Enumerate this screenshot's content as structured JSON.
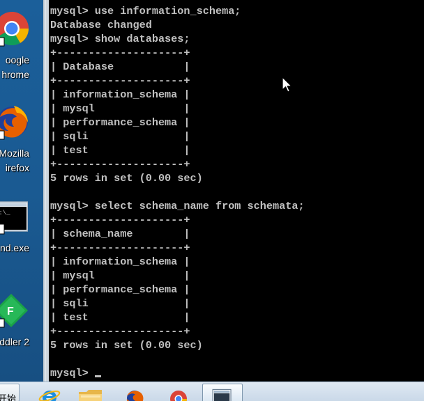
{
  "desktop": {
    "icons": [
      {
        "name": "google-chrome",
        "label_line1": "oogle",
        "label_line2": "hrome"
      },
      {
        "name": "mozilla-firefox",
        "label_line1": "Mozilla",
        "label_line2": "irefox"
      },
      {
        "name": "cmd-exe",
        "label_line1": "nd.exe",
        "label_line2": ""
      },
      {
        "name": "fiddler",
        "label_line1": "ddler 2",
        "label_line2": ""
      }
    ]
  },
  "console": {
    "lines": [
      "mysql> use information_schema;",
      "Database changed",
      "mysql> show databases;",
      "+--------------------+",
      "| Database           |",
      "+--------------------+",
      "| information_schema |",
      "| mysql              |",
      "| performance_schema |",
      "| sqli               |",
      "| test               |",
      "+--------------------+",
      "5 rows in set (0.00 sec)",
      "",
      "mysql> select schema_name from schemata;",
      "+--------------------+",
      "| schema_name        |",
      "+--------------------+",
      "| information_schema |",
      "| mysql              |",
      "| performance_schema |",
      "| sqli               |",
      "| test               |",
      "+--------------------+",
      "5 rows in set (0.00 sec)",
      ""
    ],
    "prompt": "mysql> "
  },
  "taskbar": {
    "start_label": "开始",
    "pinned": [
      "internet-explorer",
      "file-explorer",
      "firefox",
      "chrome",
      "command-prompt"
    ]
  },
  "colors": {
    "console_bg": "#000000",
    "console_fg": "#c0c0c0",
    "desktop_bg": "#1b5f9a",
    "taskbar_bg": "#dfe9f3"
  }
}
